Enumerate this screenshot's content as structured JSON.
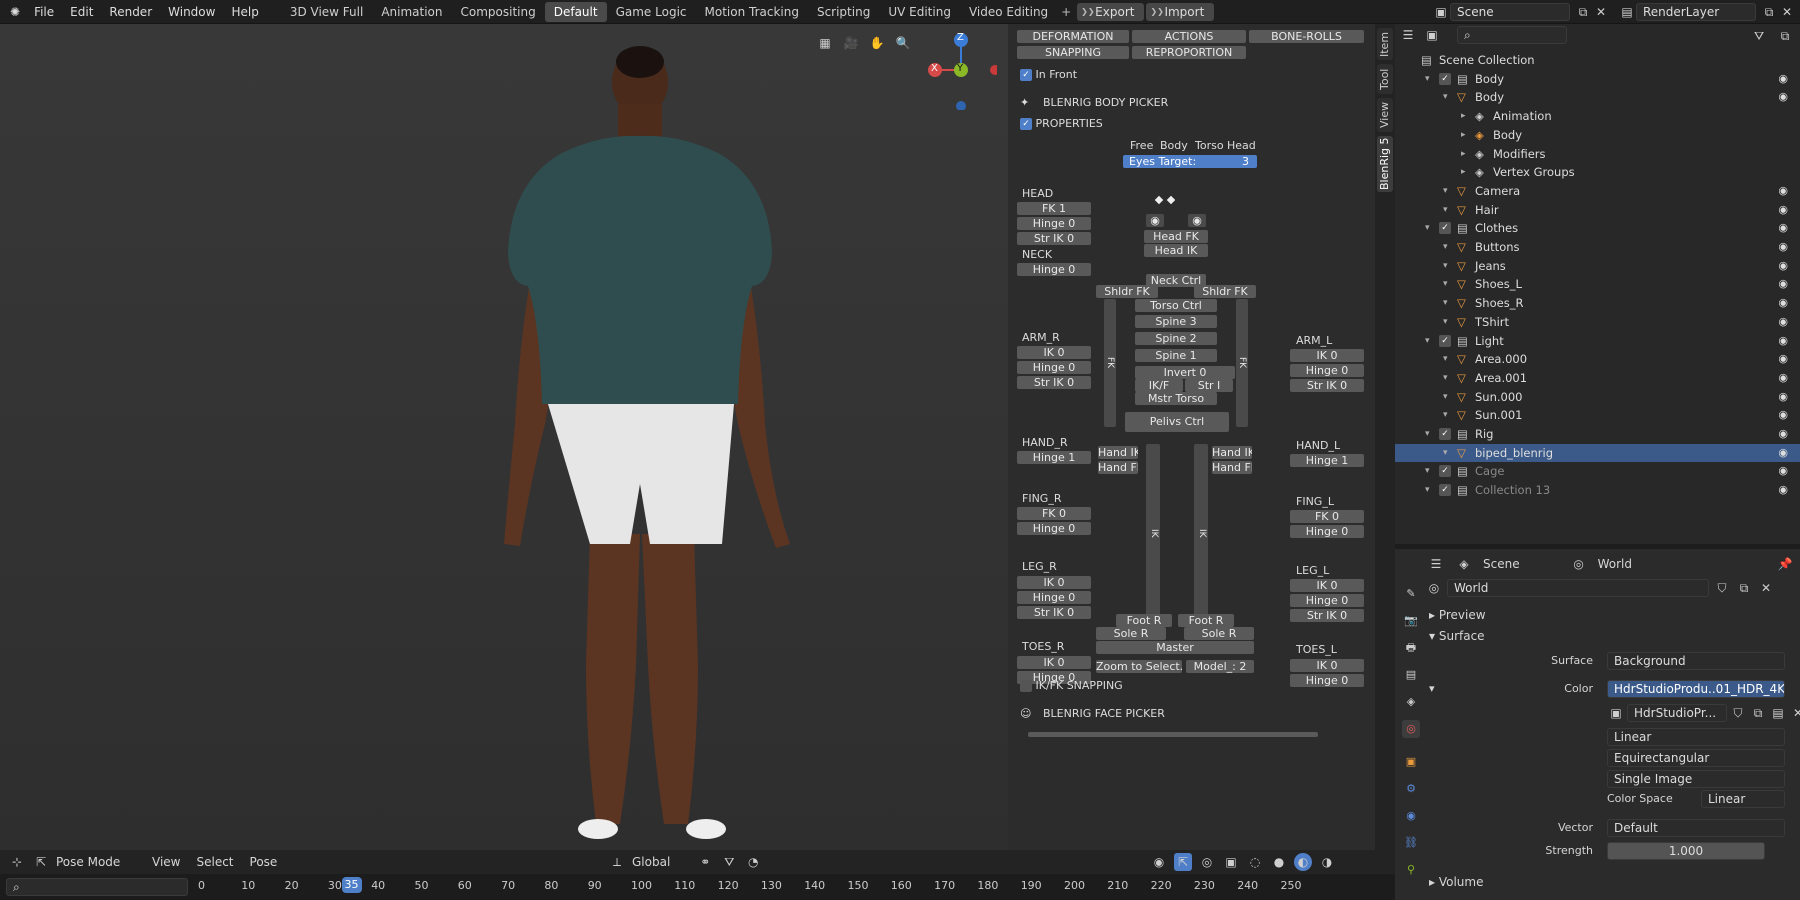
{
  "menu": {
    "file": "File",
    "edit": "Edit",
    "render": "Render",
    "window": "Window",
    "help": "Help"
  },
  "workspaces": [
    "3D View Full",
    "Animation",
    "Compositing",
    "Default",
    "Game Logic",
    "Motion Tracking",
    "Scripting",
    "UV Editing",
    "Video Editing"
  ],
  "active_workspace": "Default",
  "io": {
    "export": "Export",
    "import": "Import"
  },
  "scene_field": "Scene",
  "renderlayer_field": "RenderLayer",
  "picker": {
    "top_rows": [
      [
        "DEFORMATION",
        "ACTIONS",
        "BONE-ROLLS"
      ],
      [
        "SNAPPING",
        "REPROPORTION"
      ]
    ],
    "in_front": "In Front",
    "body_picker_title": "BLENRIG BODY PICKER",
    "properties": "PROPERTIES",
    "space_labels": [
      "Free",
      "Body",
      "Torso",
      "Head"
    ],
    "eyes_target_label": "Eyes Target:",
    "eyes_target_value": "3",
    "head_label": "HEAD",
    "head_btns": [
      "FK 1",
      "Hinge 0",
      "Str IK 0"
    ],
    "neck_label": "NECK",
    "neck_btns": [
      "Hinge 0"
    ],
    "arm_r_label": "ARM_R",
    "arm_r_btns": [
      "IK 0",
      "Hinge 0",
      "Str IK 0"
    ],
    "hand_r_label": "HAND_R",
    "hand_r_btns": [
      "Hinge 1"
    ],
    "fing_r_label": "FING_R",
    "fing_r_btns": [
      "FK 0",
      "Hinge 0"
    ],
    "leg_r_label": "LEG_R",
    "leg_r_btns": [
      "IK 0",
      "Hinge 0",
      "Str IK 0"
    ],
    "toes_r_label": "TOES_R",
    "toes_r_btns": [
      "IK 0",
      "Hinge 0"
    ],
    "arm_l_label": "ARM_L",
    "arm_l_btns": [
      "IK 0",
      "Hinge 0",
      "Str IK 0"
    ],
    "hand_l_label": "HAND_L",
    "hand_l_btns": [
      "Hinge 1"
    ],
    "fing_l_label": "FING_L",
    "fing_l_btns": [
      "FK 0",
      "Hinge 0"
    ],
    "leg_l_label": "LEG_L",
    "leg_l_btns": [
      "IK 0",
      "Hinge 0",
      "Str IK 0"
    ],
    "toes_l_label": "TOES_L",
    "toes_l_btns": [
      "IK 0",
      "Hinge 0"
    ],
    "center": {
      "head_fk": "Head FK",
      "head_ik": "Head IK",
      "neck_ctrl": "Neck Ctrl",
      "shldr_fk_r": "Shldr FK",
      "shldr_fk_l": "Shldr FK",
      "torso_ctrl": "Torso Ctrl",
      "spine3": "Spine 3",
      "spine2": "Spine 2",
      "spine1": "Spine 1",
      "invert": "Invert 0",
      "ikf": "IK/F",
      "str": "Str I",
      "mstr_torso": "Mstr Torso",
      "pelvis_ctrl": "Pelivs Ctrl",
      "hand_ik_r": "Hand IK",
      "hand_fk_r": "Hand FK",
      "hand_ik_l": "Hand IK",
      "hand_fk_l": "Hand FK",
      "foot_r": "Foot R",
      "foot_r2": "Foot R",
      "sole_r": "Sole R",
      "sole_r2": "Sole R",
      "master": "Master",
      "ik": "IK",
      "fk": "FK"
    },
    "zoom_select": "Zoom to Select..",
    "model_label": "Model_:",
    "model_value": "2",
    "ikfk_snapping": "IK/FK SNAPPING",
    "face_picker_title": "BLENRIG FACE PICKER"
  },
  "ntabs": [
    "Item",
    "Tool",
    "View",
    "BlenRig 5"
  ],
  "outliner": {
    "search_placeholder": "",
    "rows": [
      {
        "label": "Scene Collection",
        "depth": 0
      },
      {
        "label": "Body",
        "depth": 1
      },
      {
        "label": "Body",
        "depth": 2
      },
      {
        "label": "Animation",
        "depth": 3
      },
      {
        "label": "Body",
        "depth": 3
      },
      {
        "label": "Modifiers",
        "depth": 3
      },
      {
        "label": "Vertex Groups",
        "depth": 3
      },
      {
        "label": "Camera",
        "depth": 2
      },
      {
        "label": "Hair",
        "depth": 2
      },
      {
        "label": "Clothes",
        "depth": 1
      },
      {
        "label": "Buttons",
        "depth": 2
      },
      {
        "label": "Jeans",
        "depth": 2
      },
      {
        "label": "Shoes_L",
        "depth": 2
      },
      {
        "label": "Shoes_R",
        "depth": 2
      },
      {
        "label": "TShirt",
        "depth": 2
      },
      {
        "label": "Light",
        "depth": 1
      },
      {
        "label": "Area.000",
        "depth": 2
      },
      {
        "label": "Area.001",
        "depth": 2
      },
      {
        "label": "Sun.000",
        "depth": 2
      },
      {
        "label": "Sun.001",
        "depth": 2
      },
      {
        "label": "Rig",
        "depth": 1
      },
      {
        "label": "biped_blenrig",
        "depth": 2
      },
      {
        "label": "Cage",
        "depth": 1
      },
      {
        "label": "Collection 13",
        "depth": 1
      }
    ]
  },
  "properties": {
    "breadcrumb_scene": "Scene",
    "breadcrumb_world": "World",
    "world_name": "World",
    "preview": "Preview",
    "surface_section": "Surface",
    "surface_label": "Surface",
    "surface_value": "Background",
    "color_label": "Color",
    "color_value": "HdrStudioProdu..01_HDR_4K.ex",
    "image_name": "HdrStudioPr...",
    "interp": "Linear",
    "projection": "Equirectangular",
    "source": "Single Image",
    "colorspace_label": "Color Space",
    "colorspace_value": "Linear",
    "vector_label": "Vector",
    "vector_value": "Default",
    "strength_label": "Strength",
    "strength_value": "1.000",
    "volume": "Volume"
  },
  "viewport_header": {
    "mode": "Pose Mode",
    "view": "View",
    "select": "Select",
    "pose": "Pose",
    "orientation": "Global"
  },
  "gizmo": {
    "x": "X",
    "y": "Y",
    "z": "Z"
  },
  "timeline": {
    "current_frame": "35",
    "ticks": [
      "0",
      "10",
      "20",
      "30",
      "40",
      "50",
      "60",
      "70",
      "80",
      "90",
      "100",
      "110",
      "120",
      "130",
      "140",
      "150",
      "160",
      "170",
      "180",
      "190",
      "200",
      "210",
      "220",
      "230",
      "240",
      "250"
    ]
  },
  "colors": {
    "accent": "#4f7fc8",
    "selected_row": "#3b5a8a",
    "skin": "#5b3522",
    "shirt": "#2f4d4f",
    "shorts": "#e6e6e6"
  }
}
